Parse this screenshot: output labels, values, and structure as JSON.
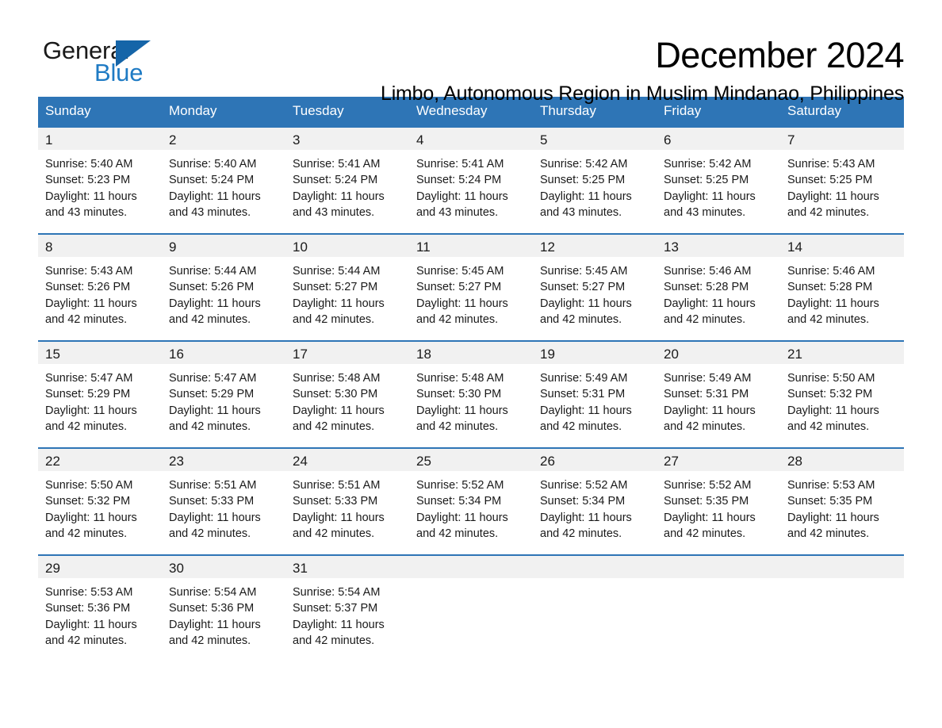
{
  "brand": {
    "name_part1": "General",
    "name_part2": "Blue",
    "logo_icon": "triangle-mark",
    "color_primary": "#2e75b6",
    "color_blue_text": "#1f7bc4"
  },
  "header": {
    "title": "December 2024",
    "subtitle": "Limbo, Autonomous Region in Muslim Mindanao, Philippines"
  },
  "calendar": {
    "weekday_headers": [
      "Sunday",
      "Monday",
      "Tuesday",
      "Wednesday",
      "Thursday",
      "Friday",
      "Saturday"
    ],
    "weeks": [
      [
        {
          "day": "1",
          "info": "Sunrise: 5:40 AM\nSunset: 5:23 PM\nDaylight: 11 hours\nand 43 minutes."
        },
        {
          "day": "2",
          "info": "Sunrise: 5:40 AM\nSunset: 5:24 PM\nDaylight: 11 hours\nand 43 minutes."
        },
        {
          "day": "3",
          "info": "Sunrise: 5:41 AM\nSunset: 5:24 PM\nDaylight: 11 hours\nand 43 minutes."
        },
        {
          "day": "4",
          "info": "Sunrise: 5:41 AM\nSunset: 5:24 PM\nDaylight: 11 hours\nand 43 minutes."
        },
        {
          "day": "5",
          "info": "Sunrise: 5:42 AM\nSunset: 5:25 PM\nDaylight: 11 hours\nand 43 minutes."
        },
        {
          "day": "6",
          "info": "Sunrise: 5:42 AM\nSunset: 5:25 PM\nDaylight: 11 hours\nand 43 minutes."
        },
        {
          "day": "7",
          "info": "Sunrise: 5:43 AM\nSunset: 5:25 PM\nDaylight: 11 hours\nand 42 minutes."
        }
      ],
      [
        {
          "day": "8",
          "info": "Sunrise: 5:43 AM\nSunset: 5:26 PM\nDaylight: 11 hours\nand 42 minutes."
        },
        {
          "day": "9",
          "info": "Sunrise: 5:44 AM\nSunset: 5:26 PM\nDaylight: 11 hours\nand 42 minutes."
        },
        {
          "day": "10",
          "info": "Sunrise: 5:44 AM\nSunset: 5:27 PM\nDaylight: 11 hours\nand 42 minutes."
        },
        {
          "day": "11",
          "info": "Sunrise: 5:45 AM\nSunset: 5:27 PM\nDaylight: 11 hours\nand 42 minutes."
        },
        {
          "day": "12",
          "info": "Sunrise: 5:45 AM\nSunset: 5:27 PM\nDaylight: 11 hours\nand 42 minutes."
        },
        {
          "day": "13",
          "info": "Sunrise: 5:46 AM\nSunset: 5:28 PM\nDaylight: 11 hours\nand 42 minutes."
        },
        {
          "day": "14",
          "info": "Sunrise: 5:46 AM\nSunset: 5:28 PM\nDaylight: 11 hours\nand 42 minutes."
        }
      ],
      [
        {
          "day": "15",
          "info": "Sunrise: 5:47 AM\nSunset: 5:29 PM\nDaylight: 11 hours\nand 42 minutes."
        },
        {
          "day": "16",
          "info": "Sunrise: 5:47 AM\nSunset: 5:29 PM\nDaylight: 11 hours\nand 42 minutes."
        },
        {
          "day": "17",
          "info": "Sunrise: 5:48 AM\nSunset: 5:30 PM\nDaylight: 11 hours\nand 42 minutes."
        },
        {
          "day": "18",
          "info": "Sunrise: 5:48 AM\nSunset: 5:30 PM\nDaylight: 11 hours\nand 42 minutes."
        },
        {
          "day": "19",
          "info": "Sunrise: 5:49 AM\nSunset: 5:31 PM\nDaylight: 11 hours\nand 42 minutes."
        },
        {
          "day": "20",
          "info": "Sunrise: 5:49 AM\nSunset: 5:31 PM\nDaylight: 11 hours\nand 42 minutes."
        },
        {
          "day": "21",
          "info": "Sunrise: 5:50 AM\nSunset: 5:32 PM\nDaylight: 11 hours\nand 42 minutes."
        }
      ],
      [
        {
          "day": "22",
          "info": "Sunrise: 5:50 AM\nSunset: 5:32 PM\nDaylight: 11 hours\nand 42 minutes."
        },
        {
          "day": "23",
          "info": "Sunrise: 5:51 AM\nSunset: 5:33 PM\nDaylight: 11 hours\nand 42 minutes."
        },
        {
          "day": "24",
          "info": "Sunrise: 5:51 AM\nSunset: 5:33 PM\nDaylight: 11 hours\nand 42 minutes."
        },
        {
          "day": "25",
          "info": "Sunrise: 5:52 AM\nSunset: 5:34 PM\nDaylight: 11 hours\nand 42 minutes."
        },
        {
          "day": "26",
          "info": "Sunrise: 5:52 AM\nSunset: 5:34 PM\nDaylight: 11 hours\nand 42 minutes."
        },
        {
          "day": "27",
          "info": "Sunrise: 5:52 AM\nSunset: 5:35 PM\nDaylight: 11 hours\nand 42 minutes."
        },
        {
          "day": "28",
          "info": "Sunrise: 5:53 AM\nSunset: 5:35 PM\nDaylight: 11 hours\nand 42 minutes."
        }
      ],
      [
        {
          "day": "29",
          "info": "Sunrise: 5:53 AM\nSunset: 5:36 PM\nDaylight: 11 hours\nand 42 minutes."
        },
        {
          "day": "30",
          "info": "Sunrise: 5:54 AM\nSunset: 5:36 PM\nDaylight: 11 hours\nand 42 minutes."
        },
        {
          "day": "31",
          "info": "Sunrise: 5:54 AM\nSunset: 5:37 PM\nDaylight: 11 hours\nand 42 minutes."
        },
        {
          "day": "",
          "info": ""
        },
        {
          "day": "",
          "info": ""
        },
        {
          "day": "",
          "info": ""
        },
        {
          "day": "",
          "info": ""
        }
      ]
    ]
  }
}
